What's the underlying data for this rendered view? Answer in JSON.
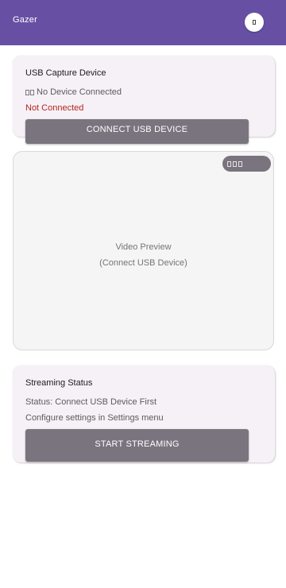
{
  "app": {
    "title": "Gazer",
    "settings_icon": "settings-icon"
  },
  "usb_card": {
    "title": "USB Capture Device",
    "device_icon": "usb-icon",
    "device_text": "No Device Connected",
    "status": "Not Connected",
    "status_color": "#b3261e",
    "connect_label": "CONNECT USB DEVICE"
  },
  "preview": {
    "toggle_icon": "preview-options-icon",
    "title": "Video Preview",
    "subtitle": "(Connect USB Device)"
  },
  "streaming": {
    "title": "Streaming Status",
    "status": "Status: Connect USB Device First",
    "hint": "Configure settings in Settings menu",
    "start_label": "START STREAMING"
  },
  "colors": {
    "accent": "#6750a4",
    "button": "#79747e",
    "card": "#f6f1f7"
  }
}
